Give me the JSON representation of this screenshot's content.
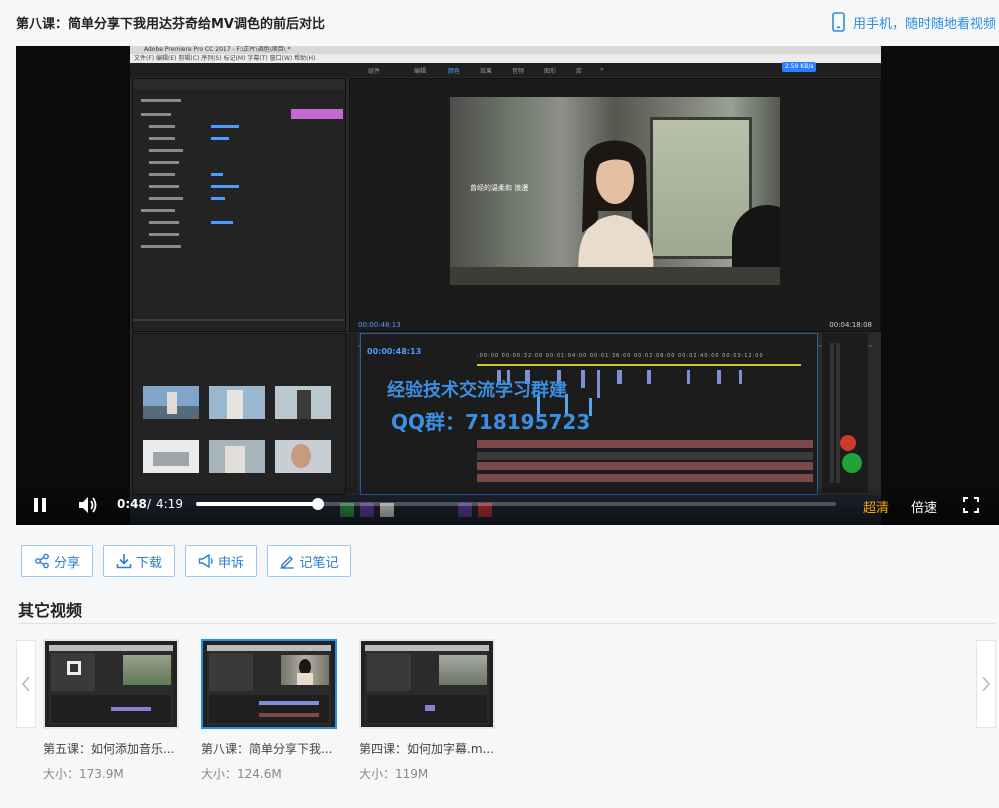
{
  "header": {
    "title": "第八课：简单分享下我用达芬奇给MV调色的前后对比",
    "mobile_link": "用手机，随时随地看视频"
  },
  "screen": {
    "app_title": "Adobe Premiere Pro CC 2017 - F:\\正片\\调色\\项目\\ *",
    "menu": "文件(F)  编辑(E)  剪辑(C)  序列(S)  标记(M)  字幕(T)  窗口(W)  帮助(H)",
    "workspaces": [
      "组件",
      "编辑",
      "颜色",
      "效果",
      "音频",
      "图形",
      "库",
      "»"
    ],
    "speed_badge": "2.59 KB/s",
    "subtitle": "曾经的温柔和 浪漫",
    "tc_left": "00:00:48:13",
    "tc_right": "00:04:18:08",
    "timeline_tc": "00:00:48:13",
    "timeline_ticks": ":00:00   00:00:32:00   00:01:04:00   00:01:36:00   00:02:08:00   00:02:40:00   00:03:12:00",
    "watermark_line1": "经验技术交流学习群建",
    "watermark_line2": "QQ群：718195723"
  },
  "player": {
    "current_time": "0:48",
    "separator": "/",
    "duration": "4:19",
    "progress_fraction": 0.19,
    "quality_label": "超清",
    "rate_label": "倍速"
  },
  "actions": {
    "share": "分享",
    "download": "下载",
    "report": "申诉",
    "notes": "记笔记"
  },
  "other_videos": {
    "heading": "其它视频",
    "items": [
      {
        "title": "第五课：如何添加音乐...",
        "size": "大小：173.9M"
      },
      {
        "title": "第八课：简单分享下我...",
        "size": "大小：124.6M"
      },
      {
        "title": "第四课：如何加字幕.m...",
        "size": "大小：119M"
      }
    ]
  },
  "colors": {
    "accent": "#2b8fe0",
    "quality": "#f0a800",
    "watermark": "#3c8fe0"
  }
}
